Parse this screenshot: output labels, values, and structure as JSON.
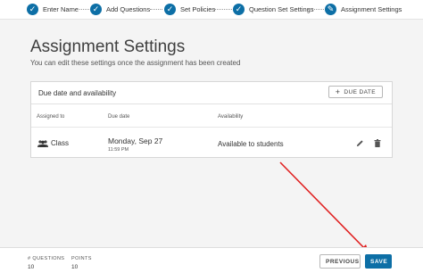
{
  "stepper": {
    "steps": [
      {
        "label": "Enter Name",
        "icon": "check-icon"
      },
      {
        "label": "Add Questions",
        "icon": "check-icon"
      },
      {
        "label": "Set Policies",
        "icon": "check-icon"
      },
      {
        "label": "Question Set Settings",
        "icon": "check-icon"
      },
      {
        "label": "Assignment Settings",
        "icon": "pencil-icon"
      }
    ]
  },
  "page": {
    "title": "Assignment Settings",
    "subtitle": "You can edit these settings once the assignment has been created"
  },
  "due_card": {
    "title": "Due date and availability",
    "add_button": "DUE DATE",
    "columns": [
      "Assigned to",
      "Due date",
      "Availability"
    ],
    "row": {
      "assigned_to": "Class",
      "due_date": "Monday, Sep 27",
      "due_time": "11:59 PM",
      "availability": "Available to students"
    }
  },
  "footer": {
    "questions_label": "# QUESTIONS",
    "questions_value": "10",
    "points_label": "POINTS",
    "points_value": "10",
    "previous_label": "PREVIOUS",
    "save_label": "SAVE"
  },
  "colors": {
    "accent": "#0d6fa6",
    "annotation_arrow": "#e02020"
  }
}
